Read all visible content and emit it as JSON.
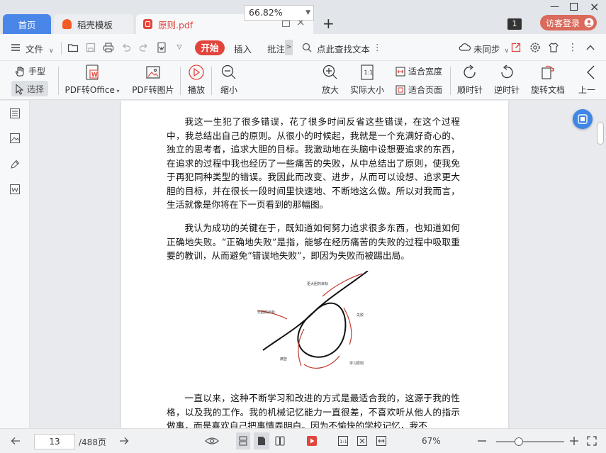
{
  "tabs": {
    "home": "首页",
    "template": "稻壳模板",
    "file": "原则.pdf",
    "badge": "1",
    "login": "访客登录"
  },
  "menu": {
    "file": "文件",
    "start": "开始",
    "insert": "插入",
    "annotate": "批注",
    "search": "点此查找文本",
    "sync": "未同步"
  },
  "ribbon": {
    "hand": "手型",
    "select": "选择",
    "pdf_to_office": "PDF转Office",
    "pdf_to_image": "PDF转图片",
    "play": "播放",
    "zoom_out": "缩小",
    "zoom_value": "66.82%",
    "zoom_in": "放大",
    "actual_size": "实际大小",
    "fit_width": "适合宽度",
    "fit_page": "适合页面",
    "rotate_cw": "顺时针",
    "rotate_ccw": "逆时针",
    "rotate_doc": "旋转文档",
    "prev": "上一"
  },
  "document": {
    "para1": "我这一生犯了很多错误，花了很多时间反省这些错误，在这个过程中，我总结出自己的原则。从很小的时候起，我就是一个充满好奇心的、独立的思考者，追求大胆的目标。我激动地在头脑中设想要追求的东西，在追求的过程中我也经历了一些痛苦的失败，从中总结出了原则，使我免于再犯同种类型的错误。我因此而改变、进步，从而可以设想、追求更大胆的目标，并在很长一段时间里快速地、不断地这么做。所以对我而言，生活就像是你将在下一页看到的那幅图。",
    "para2": "我认为成功的关键在于，既知道如何努力追求很多东西，也知道如何正确地失败。“正确地失败”是指，能够在经历痛苦的失败的过程中吸取重要的教训，从而避免“错误地失败”，即因为失败而被踢出局。",
    "para3": "一直以来，这种不断学习和改进的方式是最适合我的，这源于我的性格，以及我的工作。我的机械记忆能力一直很差，不喜欢听从他人的指示做事，而是喜欢自己把事情弄明白。因为不愉快的学校记忆，我不",
    "figure": {
      "label_top": "更大胆的目标",
      "label_left": "大胆的目标",
      "label_right": "失败",
      "label_bottom_left": "痛苦",
      "label_bottom_right": "学习原则"
    }
  },
  "status": {
    "page": "13",
    "total": "/488页",
    "zoom": "67%",
    "zoom_fraction": 0.33
  },
  "colors": {
    "accent_red": "#e1453c",
    "tab_blue": "#4a86e8",
    "login_red": "#d96a5c"
  }
}
